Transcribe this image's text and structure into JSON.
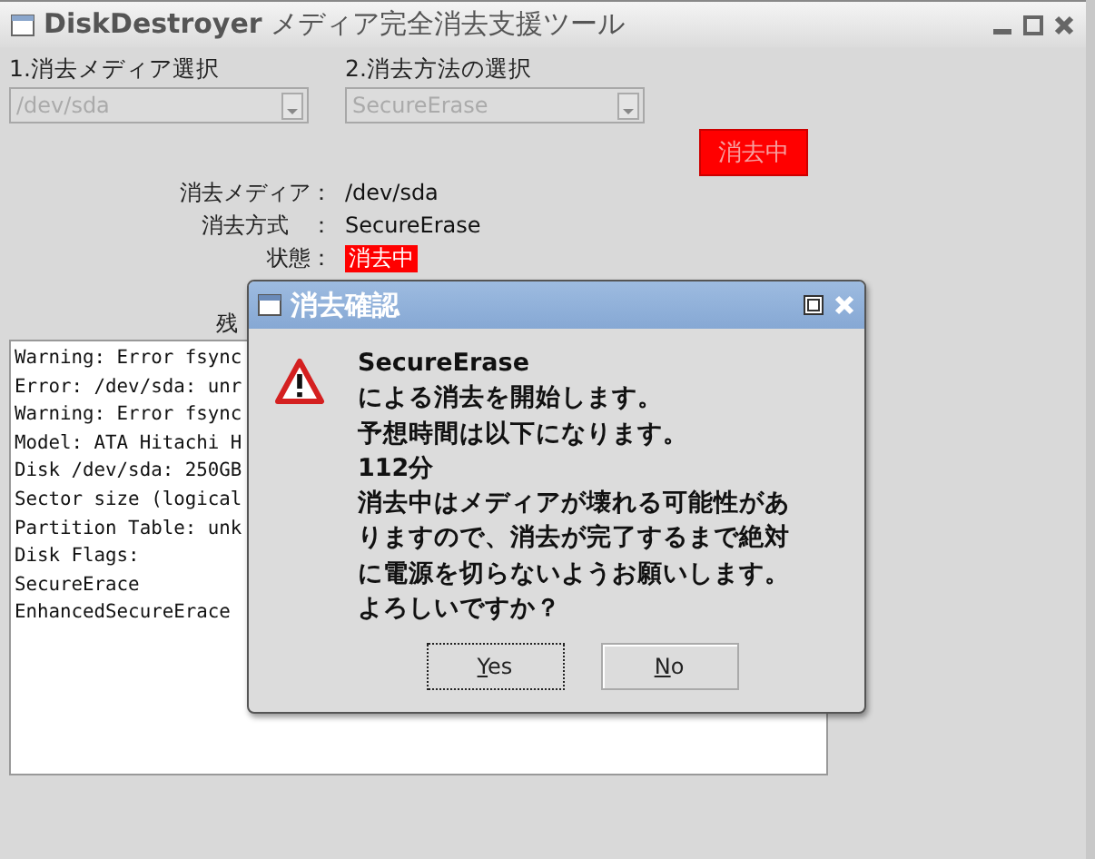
{
  "window": {
    "title": "**DiskDestroyer** メディア完全消去支援ツール"
  },
  "media_select": {
    "label": "1.消去メディア選択",
    "value": "/dev/sda",
    "disabled": true
  },
  "method_select": {
    "label": "2.消去方法の選択",
    "value": "SecureErase",
    "disabled": true
  },
  "erase_button": {
    "label": "消去中",
    "disabled": true
  },
  "info": [
    {
      "label": "消去メディア：",
      "value": "/dev/sda"
    },
    {
      "label": "消去方式　：",
      "value": "SecureErase"
    }
  ],
  "status": {
    "label": "状態：",
    "value": "消去中"
  },
  "remaining_label": "残",
  "log_lines": [
    "Warning: Error fsync",
    "Error: /dev/sda: unr",
    "Warning: Error fsync",
    "Model: ATA Hitachi H",
    "Disk /dev/sda: 250GB",
    "Sector size (logical",
    "Partition Table: unk",
    "Disk Flags:",
    "SecureErace",
    "EnhancedSecureErace"
  ],
  "dialog": {
    "title": "消去確認",
    "message": [
      "SecureErase",
      "による消去を開始します。",
      "予想時間は以下になります。",
      "112分",
      "消去中はメディアが壊れる可能性があ",
      "りますので、消去が完了するまで絶対",
      "に電源を切らないようお願いします。",
      "よろしいですか？"
    ],
    "buttons": [
      {
        "label": "Yes",
        "focused": true
      },
      {
        "label": "No",
        "focused": false
      }
    ]
  }
}
